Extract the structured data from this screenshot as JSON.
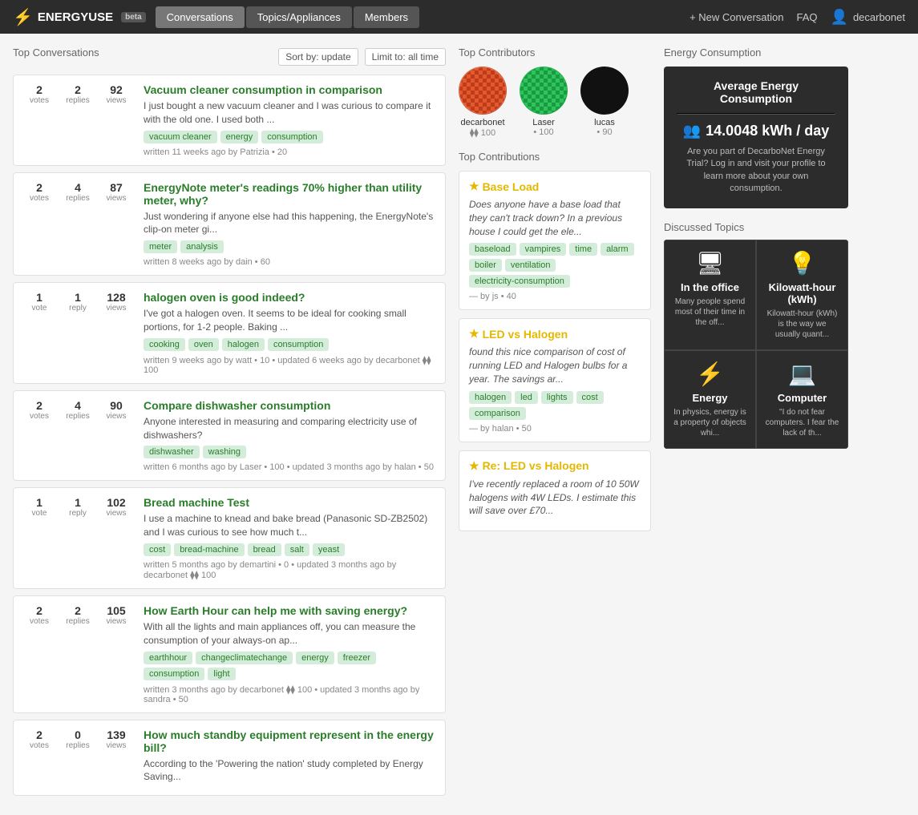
{
  "brand": {
    "name": "ENERGYUSE",
    "beta": "beta",
    "bolt": "⚡"
  },
  "nav": {
    "tabs": [
      {
        "label": "Conversations",
        "active": true
      },
      {
        "label": "Topics/Appliances",
        "active": false
      },
      {
        "label": "Members",
        "active": false
      }
    ],
    "right": {
      "new_conversation": "+ New Conversation",
      "faq": "FAQ",
      "user": "decarbonet"
    }
  },
  "left": {
    "section_title": "Top Conversations",
    "sort_label": "Sort by: update",
    "limit_label": "Limit to: all time",
    "conversations": [
      {
        "votes": 2,
        "votes_label": "votes",
        "replies": 2,
        "replies_label": "replies",
        "views": 92,
        "views_label": "views",
        "title": "Vacuum cleaner consumption in comparison",
        "excerpt": "I just bought a new vacuum cleaner and I was curious to compare it with the old one. I used both ...",
        "tags": [
          "vacuum cleaner",
          "energy",
          "consumption"
        ],
        "footer": "written 11 weeks ago by Patrizia • 20"
      },
      {
        "votes": 2,
        "votes_label": "votes",
        "replies": 4,
        "replies_label": "replies",
        "views": 87,
        "views_label": "views",
        "title": "EnergyNote meter's readings 70% higher than utility meter, why?",
        "excerpt": "Just wondering if anyone else had this happening, the EnergyNote's clip-on meter gi...",
        "tags": [
          "meter",
          "analysis"
        ],
        "footer": "written 8 weeks ago by dain • 60"
      },
      {
        "votes": 1,
        "votes_label": "vote",
        "replies": 1,
        "replies_label": "reply",
        "views": 128,
        "views_label": "views",
        "title": "halogen oven is good indeed?",
        "excerpt": "I've got a halogen oven. It seems to be ideal for cooking small portions, for 1-2 people. Baking ...",
        "tags": [
          "cooking",
          "oven",
          "halogen",
          "consumption"
        ],
        "footer": "written 9 weeks ago by watt • 10 • updated 6 weeks ago by decarbonet ⧫⧫ 100"
      },
      {
        "votes": 2,
        "votes_label": "votes",
        "replies": 4,
        "replies_label": "replies",
        "views": 90,
        "views_label": "views",
        "title": "Compare dishwasher consumption",
        "excerpt": "Anyone interested in measuring and comparing electricity use of dishwashers?",
        "tags": [
          "dishwasher",
          "washing"
        ],
        "footer": "written 6 months ago by Laser • 100 • updated 3 months ago by halan • 50"
      },
      {
        "votes": 1,
        "votes_label": "vote",
        "replies": 1,
        "replies_label": "reply",
        "views": 102,
        "views_label": "views",
        "title": "Bread machine Test",
        "excerpt": "I use a machine to knead and bake bread (Panasonic SD-ZB2502) and I was curious to see how much t...",
        "tags": [
          "cost",
          "bread-machine",
          "bread",
          "salt",
          "yeast"
        ],
        "footer": "written 5 months ago by demartini • 0 • updated 3 months ago by decarbonet ⧫⧫ 100"
      },
      {
        "votes": 2,
        "votes_label": "votes",
        "replies": 2,
        "replies_label": "replies",
        "views": 105,
        "views_label": "views",
        "title": "How Earth Hour can help me with saving energy?",
        "excerpt": "With all the lights and main appliances off, you can measure the consumption of your always-on ap...",
        "tags": [
          "earthhour",
          "changeclimatechange",
          "energy",
          "freezer",
          "consumption",
          "light"
        ],
        "footer": "written 3 months ago by decarbonet ⧫⧫ 100 • updated 3 months ago by sandra • 50"
      },
      {
        "votes": 2,
        "votes_label": "votes",
        "replies": 0,
        "replies_label": "replies",
        "views": 139,
        "views_label": "views",
        "title": "How much standby equipment represent in the energy bill?",
        "excerpt": "According to the 'Powering the nation' study completed by Energy Saving...",
        "tags": [],
        "footer": ""
      }
    ]
  },
  "mid": {
    "contributors_title": "Top Contributors",
    "contributors": [
      {
        "name": "decarbonet",
        "score": 100,
        "type": "red"
      },
      {
        "name": "Laser",
        "score": 100,
        "type": "green"
      },
      {
        "name": "lucas",
        "score": 90,
        "type": "black"
      }
    ],
    "contributions_title": "Top Contributions",
    "contributions": [
      {
        "title": "Base Load",
        "text": "Does anyone have a base load that they can't track down? In a previous house I could get the ele...",
        "tags": [
          "baseload",
          "vampires",
          "time",
          "alarm",
          "boiler",
          "ventilation",
          "electricity-consumption"
        ],
        "footer": "— by js • 40"
      },
      {
        "title": "LED vs Halogen",
        "text": "found this nice comparison of cost of running LED and Halogen bulbs for a year. The savings ar...",
        "tags": [
          "halogen",
          "led",
          "lights",
          "cost",
          "comparison"
        ],
        "footer": "— by halan • 50"
      },
      {
        "title": "Re: LED vs Halogen",
        "text": "I've recently replaced a room of 10 50W halogens with 4W LEDs. I estimate this will save over £70...",
        "tags": [],
        "footer": ""
      }
    ]
  },
  "right": {
    "energy_title": "Energy Consumption",
    "panel_title": "Average Energy Consumption",
    "kwh_value": "14.0048 kWh / day",
    "kwh_icon": "👥",
    "energy_desc": "Are you part of DecarboNet Energy Trial? Log in and visit your profile to learn more about your own consumption.",
    "discussed_title": "Discussed Topics",
    "topics": [
      {
        "icon": "🖥",
        "name": "In the office",
        "desc": "Many people spend most of their time in the off..."
      },
      {
        "icon": "💡",
        "name": "Kilowatt-hour (kWh)",
        "desc": "Kilowatt-hour (kWh) is the way we usually quant..."
      },
      {
        "icon": "⚡",
        "name": "Energy",
        "desc": "In physics, energy is a property of objects whi..."
      },
      {
        "icon": "💻",
        "name": "Computer",
        "desc": "\"I do not fear computers. I fear the lack of th..."
      }
    ]
  }
}
